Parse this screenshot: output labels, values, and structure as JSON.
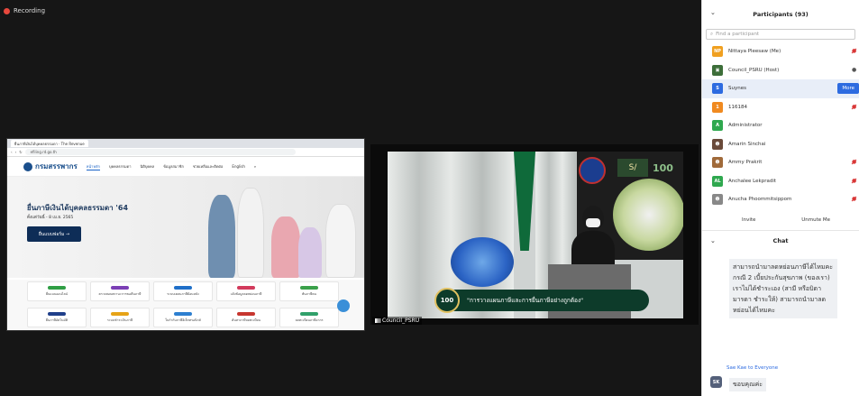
{
  "recording": {
    "label": "Recording",
    "color": "#e8483d"
  },
  "shared_screen": {
    "browser_tab": "ยื่นภาษีเงินได้บุคคลธรรมดา · The Revenue",
    "browser_url": "efiling.rd.go.th",
    "site_logo": "กรมสรรพากร",
    "site_logo_sub": "THE REVENUE DEPARTMENT",
    "nav": [
      "หน้าหลัก",
      "บุคคลธรรมดา",
      "นิติบุคคล",
      "ข้อมูลสมาชิก",
      "ช่วยเหลือและติดต่อ",
      "English"
    ],
    "hero_title": "ยื่นภาษีเงินได้บุคคลธรรมดา '64",
    "hero_sub": "ตั้งแต่วันนี้ - 8 เม.ย. 2565",
    "hero_button": "ยื่นแบบฟอร์ม →",
    "services": [
      {
        "label": "ยื่นแบบออนไลน์",
        "color": "#2f9e44"
      },
      {
        "label": "ตรวจสอบสถานะการขอคืนภาษี",
        "color": "#7b3fb5"
      },
      {
        "label": "ระบบเคลมภาษีย้อนหลัง",
        "color": "#1f6fc8"
      },
      {
        "label": "แจ้งข้อมูลลดหย่อนภาษี",
        "color": "#d23a5c"
      },
      {
        "label": "พ้นภาษีคน",
        "color": "#3aa04a"
      },
      {
        "label": "ยื่นภาษีอัตโนมัติ",
        "color": "#1f3f8a"
      },
      {
        "label": "ระบบชำระเงินภาษี",
        "color": "#e6a317"
      },
      {
        "label": "ใบกำกับภาษีอิเล็กทรอนิกส์",
        "color": "#2d7fd0"
      },
      {
        "label": "ค้นหาภาษีจดทะเบียน",
        "color": "#c7362f"
      },
      {
        "label": "จดทะเบียนภาษีอากร",
        "color": "#30a06a"
      }
    ]
  },
  "video_tile": {
    "name": "Council_PSRU",
    "lower_third": "\"การวางแผนภาษีและการยื่นภาษีอย่างถูกต้อง\"",
    "badge": "100",
    "sc_logo": "S/",
    "logo_100": "100"
  },
  "participants_panel": {
    "title": "Participants (93)",
    "search_placeholder": "Find a participant",
    "participants": [
      {
        "name": "Nittaya Pleesaw (Me)",
        "initials": "NP",
        "color": "#f0a020",
        "mic": "off"
      },
      {
        "name": "Council_PSRU (Host)",
        "initials": "",
        "color": "#3d6e3a",
        "mic": "on"
      },
      {
        "name": "Suynes",
        "initials": "S",
        "color": "#2d6be0",
        "mic": "",
        "selected": true
      },
      {
        "name": "116184",
        "initials": "1",
        "color": "#f08a20",
        "mic": "off"
      },
      {
        "name": "Administrator",
        "initials": "A",
        "color": "#2fa84f",
        "mic": ""
      },
      {
        "name": "Amarin Sinchai",
        "initials": "",
        "color": "#6a4a3a",
        "mic": ""
      },
      {
        "name": "Ammy Prakrit",
        "initials": "",
        "color": "#a06a3a",
        "mic": "off"
      },
      {
        "name": "Anchalee Lekpradit",
        "initials": "AL",
        "color": "#2fa84f",
        "mic": "off"
      },
      {
        "name": "Anucha Phoommitsippom",
        "initials": "",
        "color": "#888888",
        "mic": "off"
      }
    ],
    "more_button": "More",
    "invite_button": "Invite",
    "unmute_button": "Unmute Me"
  },
  "chat_panel": {
    "title": "Chat",
    "message": "สามารถนำมาลดหย่อนภาษีได้ไหมคะ กรณี 2 เบี้ยประกันสุขภาพ (ของเรา) เราไม่ได้ชำระเอง (สามี หรือบิดามารดา ชำระให้) สามารถนำมาลดหย่อนได้ไหมคะ",
    "to_line": "Sae Kae to Everyone",
    "sender_initials": "SK",
    "reply": "ขอบคุณค่ะ"
  }
}
